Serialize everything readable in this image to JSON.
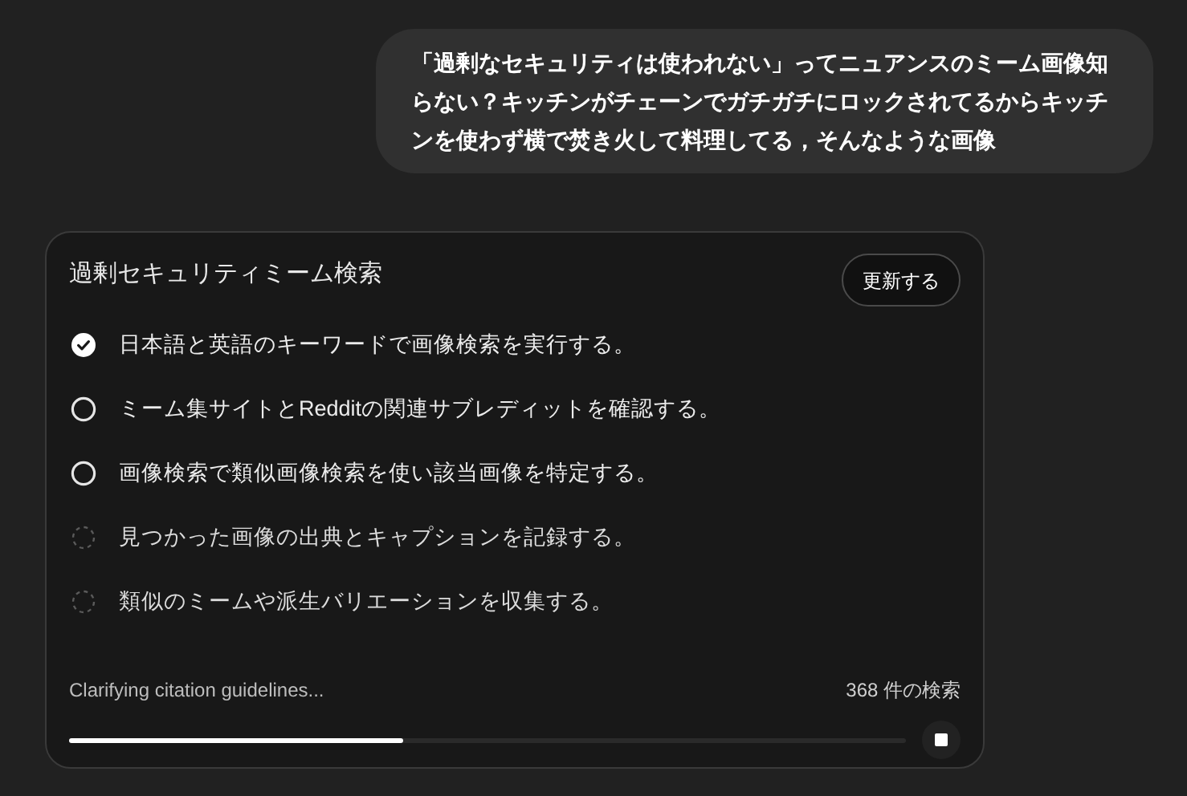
{
  "user_message": "「過剰なセキュリティは使われない」ってニュアンスのミーム画像知らない？キッチンがチェーンでガチガチにロックされてるからキッチンを使わず横で焚き火して料理してる，そんなような画像",
  "task_card": {
    "title": "過剰セキュリティミーム検索",
    "refresh_button": "更新する",
    "steps": [
      {
        "kind": "done",
        "text": "日本語と英語のキーワードで画像検索を実行する。"
      },
      {
        "kind": "open",
        "text": "ミーム集サイトとRedditの関連サブレディットを確認する。"
      },
      {
        "kind": "open",
        "text": "画像検索で類似画像検索を使い該当画像を特定する。"
      },
      {
        "kind": "pending",
        "text": "見つかった画像の出典とキャプションを記録する。"
      },
      {
        "kind": "pending",
        "text": "類似のミームや派生バリエーションを収集する。"
      }
    ],
    "status_text": "Clarifying citation guidelines...",
    "search_count": "368 件の検索",
    "progress": {
      "level": 0.4
    }
  }
}
